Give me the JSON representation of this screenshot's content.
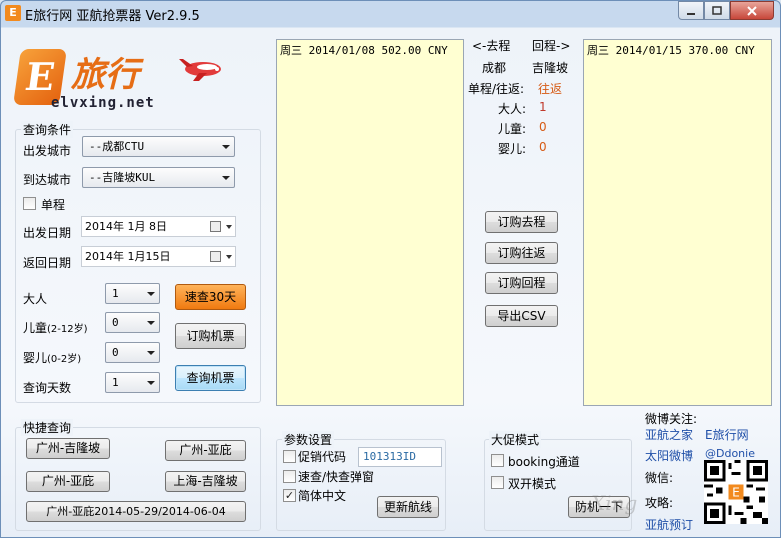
{
  "window": {
    "title": "E旅行网 亚航抢票器  Ver2.9.5",
    "app_icon": "E"
  },
  "logo": {
    "mark": "E",
    "cn": "旅行",
    "en": "elvxing.net"
  },
  "query": {
    "group_label": "查询条件",
    "from_label": "出发城市",
    "from_value": "--成都CTU",
    "to_label": "到达城市",
    "to_value": "--吉隆坡KUL",
    "oneway_label": "单程",
    "depart_label": "出发日期",
    "depart_value": "2014年  1月  8日",
    "return_label": "返回日期",
    "return_value": "2014年  1月15日",
    "adult_label": "大人",
    "adult_value": "1",
    "child_label": "儿童",
    "child_sub": "(2-12岁)",
    "child_value": "0",
    "infant_label": "婴儿",
    "infant_sub": "(0-2岁)",
    "infant_value": "0",
    "days_label": "查询天数",
    "days_value": "1",
    "btn_fast30": "速查30天",
    "btn_book": "订购机票",
    "btn_search": "查询机票"
  },
  "outbound_list": [
    "周三  2014/01/08  502.00  CNY"
  ],
  "return_list": [
    "周三  2014/01/15  370.00  CNY"
  ],
  "summary": {
    "outbound_head": "<-去程",
    "return_head": "回程->",
    "from_city": "成都",
    "to_city": "吉隆坡",
    "trip_type_label": "单程/往返:",
    "trip_type_value": "往返",
    "adult_label": "大人:",
    "adult_value": "1",
    "child_label": "儿童:",
    "child_value": "0",
    "infant_label": "婴儿:",
    "infant_value": "0"
  },
  "actions": {
    "book_outbound": "订购去程",
    "book_roundtrip": "订购往返",
    "book_return": "订购回程",
    "export_csv": "导出CSV"
  },
  "quick": {
    "group_label": "快捷查询",
    "items": [
      "广州-吉隆坡",
      "广州-亚庇",
      "广州-亚庇",
      "上海-吉隆坡",
      "广州-亚庇2014-05-29/2014-06-04"
    ]
  },
  "params": {
    "group_label": "参数设置",
    "promo_label": "促销代码",
    "promo_value": "101313ID",
    "popup_label": "速查/快查弹窗",
    "simplified_label": "简体中文",
    "update_btn": "更新航线"
  },
  "promo_mode": {
    "group_label": "大促模式",
    "booking_label": "booking通道",
    "double_label": "双开模式",
    "anti_btn": "防机一下"
  },
  "weibo": {
    "follow_label": "微博关注:",
    "link1": "亚航之家",
    "link2": "E旅行网",
    "link3": "太阳微博",
    "link4": "@Ddonie",
    "wechat_label": "微信:",
    "guide_label": "攻略:",
    "link5": "亚航预订"
  },
  "watermark": "Xing"
}
